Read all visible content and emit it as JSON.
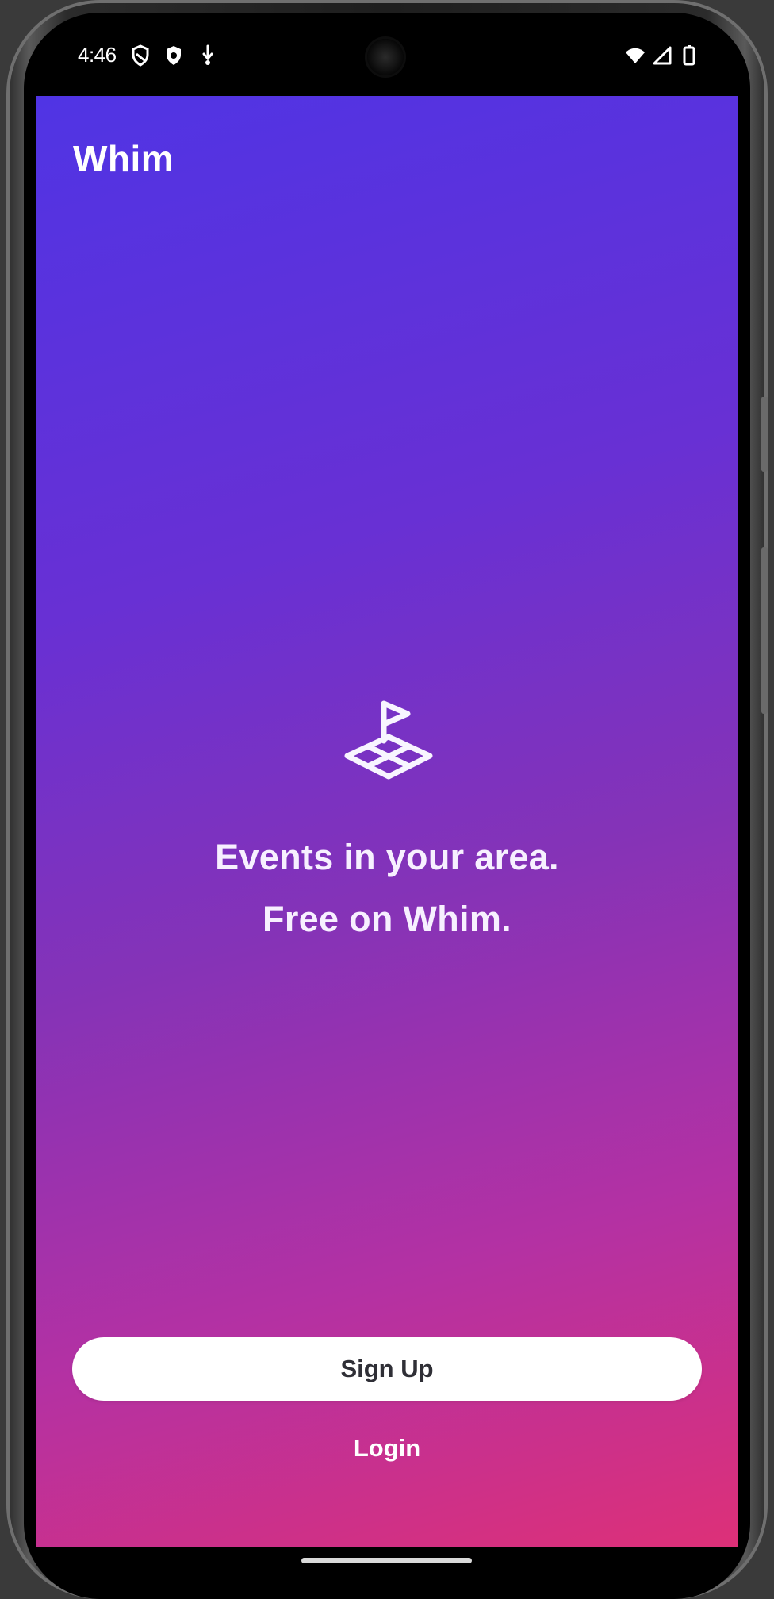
{
  "status_bar": {
    "time": "4:46",
    "icons": {
      "vpn": "vpn-shield-icon",
      "security": "security-shield-icon",
      "download": "download-icon",
      "wifi": "wifi-icon",
      "signal": "cell-signal-icon",
      "battery": "battery-icon"
    }
  },
  "app": {
    "title": "Whim",
    "hero_icon": "map-flag-icon",
    "headline_line_1": "Events in your area.",
    "headline_line_2": "Free on Whim.",
    "signup_label": "Sign Up",
    "login_label": "Login"
  },
  "colors": {
    "gradient_start": "#5034e4",
    "gradient_middle": "#8533b7",
    "gradient_end": "#dd3078",
    "button_background": "#ffffff",
    "button_text": "#2f2f36",
    "text": "#ffffff"
  }
}
